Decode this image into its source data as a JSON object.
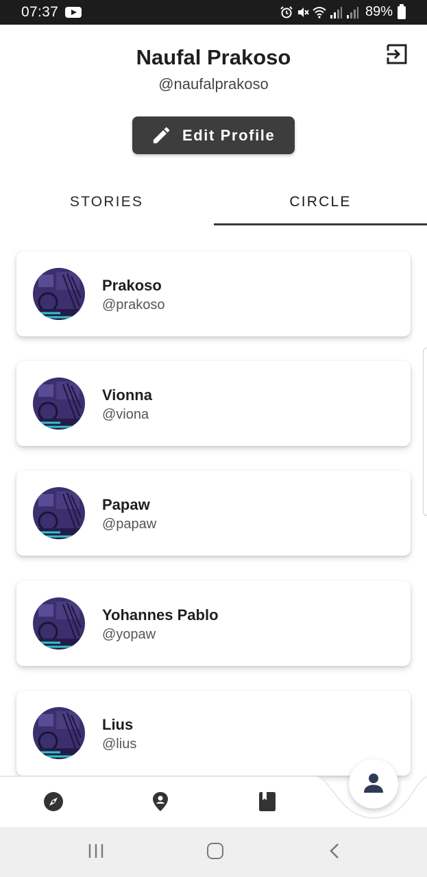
{
  "status_bar": {
    "time": "07:37",
    "battery": "89%"
  },
  "profile": {
    "name": "Naufal Prakoso",
    "handle": "@naufalprakoso",
    "edit_button_label": "Edit Profile"
  },
  "tabs": [
    {
      "label": "STORIES",
      "selected": false
    },
    {
      "label": "CIRCLE",
      "selected": true
    }
  ],
  "circle": [
    {
      "name": "Prakoso",
      "handle": "@prakoso"
    },
    {
      "name": "Vionna",
      "handle": "@viona"
    },
    {
      "name": "Papaw",
      "handle": "@papaw"
    },
    {
      "name": "Yohannes Pablo",
      "handle": "@yopaw"
    },
    {
      "name": "Lius",
      "handle": "@lius"
    }
  ],
  "bottom_nav": {
    "items": [
      "compass-icon",
      "map-pin-icon",
      "book-icon"
    ],
    "fab": "person-icon"
  },
  "colors": {
    "status_bar": "#1c1c1c",
    "button_dark": "#3d3d3d",
    "avatar_purple": "#3b2f6e",
    "avatar_teal": "#2fc6c9",
    "nav_icon": "#333333",
    "fab_icon": "#2f3a56"
  }
}
